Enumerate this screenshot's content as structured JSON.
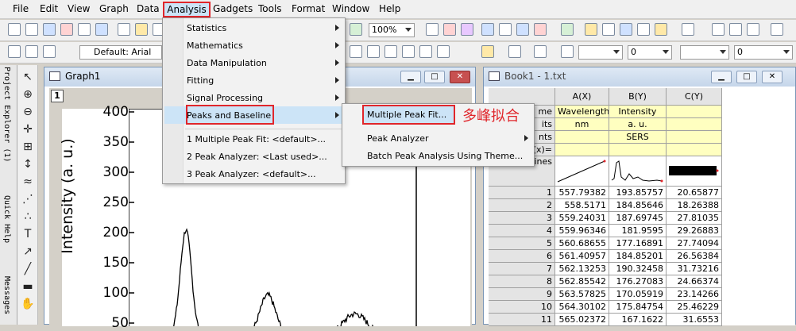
{
  "menubar": {
    "items": [
      "File",
      "Edit",
      "View",
      "Graph",
      "Data",
      "Analysis",
      "Gadgets",
      "Tools",
      "Format",
      "Window",
      "Help"
    ]
  },
  "toolbar": {
    "zoom_value": "100%",
    "font_value": "Default: Arial",
    "fontsize_value": "0",
    "linewidth_value": "0",
    "fillsize_value": "0"
  },
  "leftdock": {
    "project_explorer": "Project Explorer (1)",
    "quick_help": "Quick Help",
    "messages": "Messages"
  },
  "graph": {
    "title": "Graph1",
    "layer": "1",
    "ylabel": "Intensity (a. u.)",
    "yticks": [
      "400",
      "350",
      "300",
      "250",
      "200",
      "150",
      "100",
      "50"
    ],
    "ylim": [
      0,
      400
    ],
    "line_color": "#000000"
  },
  "book": {
    "title": "Book1 - 1.txt",
    "columns": [
      "A(X)",
      "B(Y)",
      "C(Y)"
    ],
    "row_labels": [
      "me",
      "its",
      "nts",
      "(x)=",
      "parklines"
    ],
    "long_name": [
      "Wavelength",
      "Intensity",
      ""
    ],
    "units": [
      "nm",
      "a. u.",
      ""
    ],
    "comments": [
      "",
      "SERS",
      ""
    ],
    "rows": [
      {
        "n": "1",
        "a": "557.79382",
        "b": "193.85757",
        "c": "20.65877"
      },
      {
        "n": "2",
        "a": "558.5171",
        "b": "184.85646",
        "c": "18.26388"
      },
      {
        "n": "3",
        "a": "559.24031",
        "b": "187.69745",
        "c": "27.81035"
      },
      {
        "n": "4",
        "a": "559.96346",
        "b": "181.9595",
        "c": "29.26883"
      },
      {
        "n": "5",
        "a": "560.68655",
        "b": "177.16891",
        "c": "27.74094"
      },
      {
        "n": "6",
        "a": "561.40957",
        "b": "184.85201",
        "c": "26.56384"
      },
      {
        "n": "7",
        "a": "562.13253",
        "b": "190.32458",
        "c": "31.73216"
      },
      {
        "n": "8",
        "a": "562.85542",
        "b": "176.27083",
        "c": "24.66374"
      },
      {
        "n": "9",
        "a": "563.57825",
        "b": "170.05919",
        "c": "23.14266"
      },
      {
        "n": "10",
        "a": "564.30102",
        "b": "175.84754",
        "c": "25.46229"
      },
      {
        "n": "11",
        "a": "565.02372",
        "b": "167.1622",
        "c": "31.6553"
      }
    ]
  },
  "analysis_menu": {
    "items": [
      {
        "label": "Statistics",
        "submenu": true
      },
      {
        "label": "Mathematics",
        "submenu": true
      },
      {
        "label": "Data Manipulation",
        "submenu": true
      },
      {
        "label": "Fitting",
        "submenu": true
      },
      {
        "label": "Signal Processing",
        "submenu": true
      },
      {
        "label": "Peaks and Baseline",
        "submenu": true
      }
    ],
    "recent": [
      "1 Multiple Peak Fit: <default>...",
      "2 Peak Analyzer: <Last used>...",
      "3 Peak Analyzer: <default>..."
    ]
  },
  "peaks_submenu": {
    "items": [
      "Multiple Peak Fit...",
      "Peak Analyzer",
      "Batch Peak Analysis Using Theme..."
    ]
  },
  "annotation": {
    "text": "多峰拟合",
    "color": "#e0262b"
  }
}
